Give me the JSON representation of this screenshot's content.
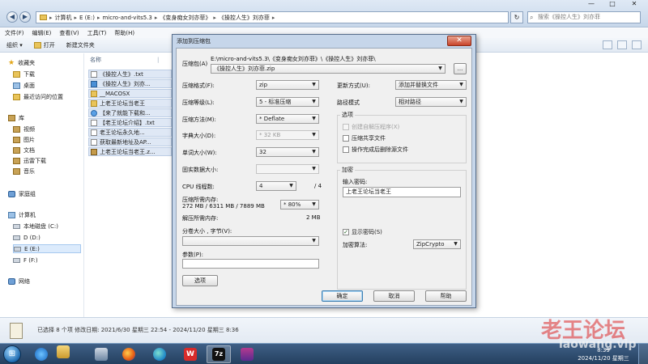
{
  "explorer": {
    "breadcrumb": [
      "计算机",
      "E (E:)",
      "micro-and-vits5.3",
      "《变身痴女刘亦菲》",
      "《操控人生》刘亦菲"
    ],
    "search_placeholder": "搜索《操控人生》刘亦菲",
    "window_controls": [
      "—",
      "□",
      "✕"
    ],
    "menu": [
      "文件(F)",
      "编辑(E)",
      "查看(V)",
      "工具(T)",
      "帮助(H)"
    ],
    "toolbar": {
      "organize": "组织 ▾",
      "open": "打开",
      "new_folder": "新建文件夹"
    },
    "sidebar": {
      "favorites": "收藏夹",
      "favorites_items": [
        "下载",
        "桌面",
        "最近访问的位置"
      ],
      "libraries": "库",
      "libraries_items": [
        "视频",
        "图片",
        "文档",
        "迅雷下载",
        "音乐"
      ],
      "homegroup": "家庭组",
      "computer": "计算机",
      "computer_items": [
        "本地磁盘 (C:)",
        "D (D:)",
        "E (E:)",
        "F (F:)"
      ],
      "network": "网络"
    },
    "list_header": "名称",
    "files": [
      {
        "name": "《操控人生》.txt",
        "icon": "txt-icon"
      },
      {
        "name": "《操控人生》刘亦...",
        "icon": "image-icon"
      },
      {
        "name": "__MACOSX",
        "icon": "folder-icon"
      },
      {
        "name": "上老王论坛当老王",
        "icon": "folder-icon"
      },
      {
        "name": "【来了就能下载和...",
        "icon": "url-icon"
      },
      {
        "name": "【老王论坛介绍】.txt",
        "icon": "txt-icon"
      },
      {
        "name": "老王论坛永久地...",
        "icon": "txt-icon"
      },
      {
        "name": "获取最新地址及AP...",
        "icon": "txt-icon"
      },
      {
        "name": "上老王论坛当老王.z...",
        "icon": "zip-icon"
      }
    ],
    "details": "已选择 8 个项  修改日期: 2021/6/30 星期三 22:54 - 2024/11/20 星期三 8:36"
  },
  "dialog": {
    "title": "添加到压缩包",
    "close": "✕",
    "archive_label": "压缩包(A)",
    "archive_path": "E:\\micro-and-vits5.3\\《变身痴女刘亦菲》\\《操控人生》刘亦菲\\",
    "archive_name": "《操控人生》刘亦菲.zip",
    "browse_button": "...",
    "format_label": "压缩格式(F):",
    "format_value": "zip",
    "level_label": "压缩等级(L):",
    "level_value": "5 - 标准压缩",
    "method_label": "压缩方法(M):",
    "method_value": "* Deflate",
    "dict_label": "字典大小(D):",
    "dict_value": "* 32 KB",
    "word_label": "单词大小(W):",
    "word_value": "32",
    "solid_label": "固实数据大小:",
    "solid_value": "",
    "threads_label": "CPU 线程数:",
    "threads_value": "4",
    "threads_max": "/ 4",
    "mem_label": "压缩所需内存:",
    "mem_detail": "272 MB / 6311 MB / 7889 MB",
    "mem_percent": "* 80%",
    "decomp_label": "解压所需内存:",
    "decomp_value": "2 MB",
    "split_label": "分卷大小 , 字节(V):",
    "split_value": "",
    "params_label": "参数(P):",
    "params_value": "",
    "options_button": "选项",
    "update_label": "更新方式(U):",
    "update_value": "添加并替换文件",
    "path_label": "路径模式",
    "path_value": "相对路径",
    "options_group": "选项",
    "opt_sfx": "创建自解压程序(X)",
    "opt_shared": "压缩共享文件",
    "opt_delete": "操作完成后删除源文件",
    "encrypt_group": "加密",
    "password_label": "输入密码:",
    "password_value": "上老王论坛当老王",
    "show_password": "显示密码(S)",
    "enc_method_label": "加密算法:",
    "enc_method_value": "ZipCrypto",
    "ok": "确定",
    "cancel": "取消",
    "help": "帮助"
  },
  "taskbar": {
    "start": "⊞",
    "apps": [
      "ie-icon",
      "explorer-icon",
      "app-icon",
      "firefox-icon",
      "edge-icon",
      "wps-icon",
      "7zip-icon",
      "winrar-icon"
    ],
    "wps_glyph": "W",
    "sevenzip_glyph": "7z",
    "time": "8:39",
    "date": "2024/11/20 星期三"
  },
  "watermark": {
    "title": "老王论坛",
    "url": "laowang.vip"
  }
}
